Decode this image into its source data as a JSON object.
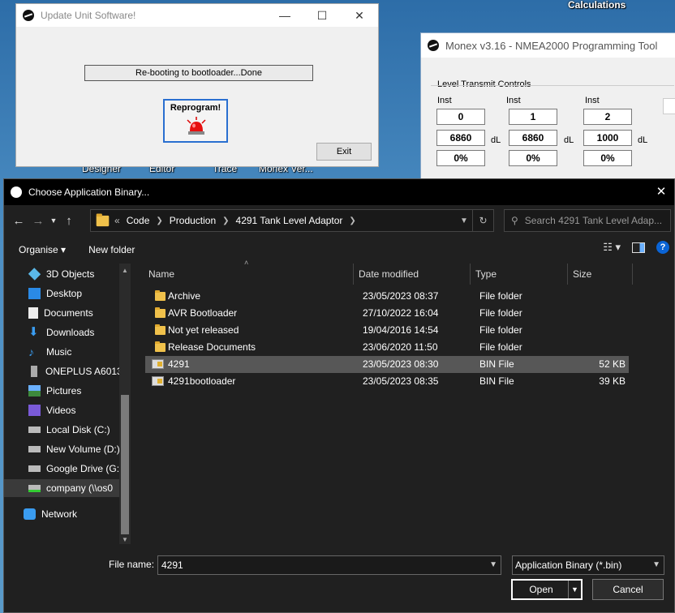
{
  "desktop": {
    "labels": [
      "Calculations",
      "Designer",
      "Editor",
      "Trace",
      "Monex Ver..."
    ]
  },
  "monex_window": {
    "title": "Monex v3.16 - NMEA2000 Programming Tool",
    "group_title": "Level Transmit Controls",
    "columns": [
      {
        "inst_label": "Inst",
        "inst": "0",
        "level": "6860",
        "unit": "dL",
        "percent": "0%"
      },
      {
        "inst_label": "Inst",
        "inst": "1",
        "level": "6860",
        "unit": "dL",
        "percent": "0%"
      },
      {
        "inst_label": "Inst",
        "inst": "2",
        "level": "1000",
        "unit": "dL",
        "percent": "0%"
      }
    ]
  },
  "update_window": {
    "title": "Update Unit Software!",
    "status": "Re-booting to bootloader...Done",
    "reprogram_label": "Reprogram!",
    "exit_label": "Exit",
    "minimize": "—",
    "maximize": "☐",
    "close": "✕"
  },
  "dialog": {
    "title": "Choose Application Binary...",
    "close": "✕",
    "breadcrumb": [
      "Code",
      "Production",
      "4291 Tank Level Adaptor"
    ],
    "breadcrumb_prefix": "«",
    "search_placeholder": "Search 4291 Tank Level Adap...",
    "toolbar": {
      "organise": "Organise ▾",
      "new_folder": "New folder"
    },
    "nav_items": [
      {
        "label": "3D Objects",
        "icon": "cube-icon"
      },
      {
        "label": "Desktop",
        "icon": "desktop-icon"
      },
      {
        "label": "Documents",
        "icon": "documents-icon"
      },
      {
        "label": "Downloads",
        "icon": "download-icon"
      },
      {
        "label": "Music",
        "icon": "music-icon"
      },
      {
        "label": "ONEPLUS A6013",
        "icon": "phone-icon"
      },
      {
        "label": "Pictures",
        "icon": "pictures-icon"
      },
      {
        "label": "Videos",
        "icon": "videos-icon"
      },
      {
        "label": "Local Disk (C:)",
        "icon": "drive-icon"
      },
      {
        "label": "New Volume (D:)",
        "icon": "drive-icon"
      },
      {
        "label": "Google Drive (G:)",
        "icon": "drive-icon"
      },
      {
        "label": "company (\\\\os0",
        "icon": "network-drive-icon"
      },
      {
        "label": "Network",
        "icon": "network-icon"
      }
    ],
    "columns": {
      "name": "Name",
      "date": "Date modified",
      "type": "Type",
      "size": "Size"
    },
    "files": [
      {
        "name": "Archive",
        "date": "23/05/2023 08:37",
        "type": "File folder",
        "size": "",
        "kind": "folder"
      },
      {
        "name": "AVR Bootloader",
        "date": "27/10/2022 16:04",
        "type": "File folder",
        "size": "",
        "kind": "folder"
      },
      {
        "name": "Not yet released",
        "date": "19/04/2016 14:54",
        "type": "File folder",
        "size": "",
        "kind": "folder"
      },
      {
        "name": "Release Documents",
        "date": "23/06/2020 11:50",
        "type": "File folder",
        "size": "",
        "kind": "folder"
      },
      {
        "name": "4291",
        "date": "23/05/2023 08:30",
        "type": "BIN File",
        "size": "52 KB",
        "kind": "bin"
      },
      {
        "name": "4291bootloader",
        "date": "23/05/2023 08:35",
        "type": "BIN File",
        "size": "39 KB",
        "kind": "bin"
      }
    ],
    "filename_label": "File name:",
    "filename_value": "4291",
    "filetype_value": "Application Binary (*.bin)",
    "open_label": "Open",
    "cancel_label": "Cancel"
  }
}
